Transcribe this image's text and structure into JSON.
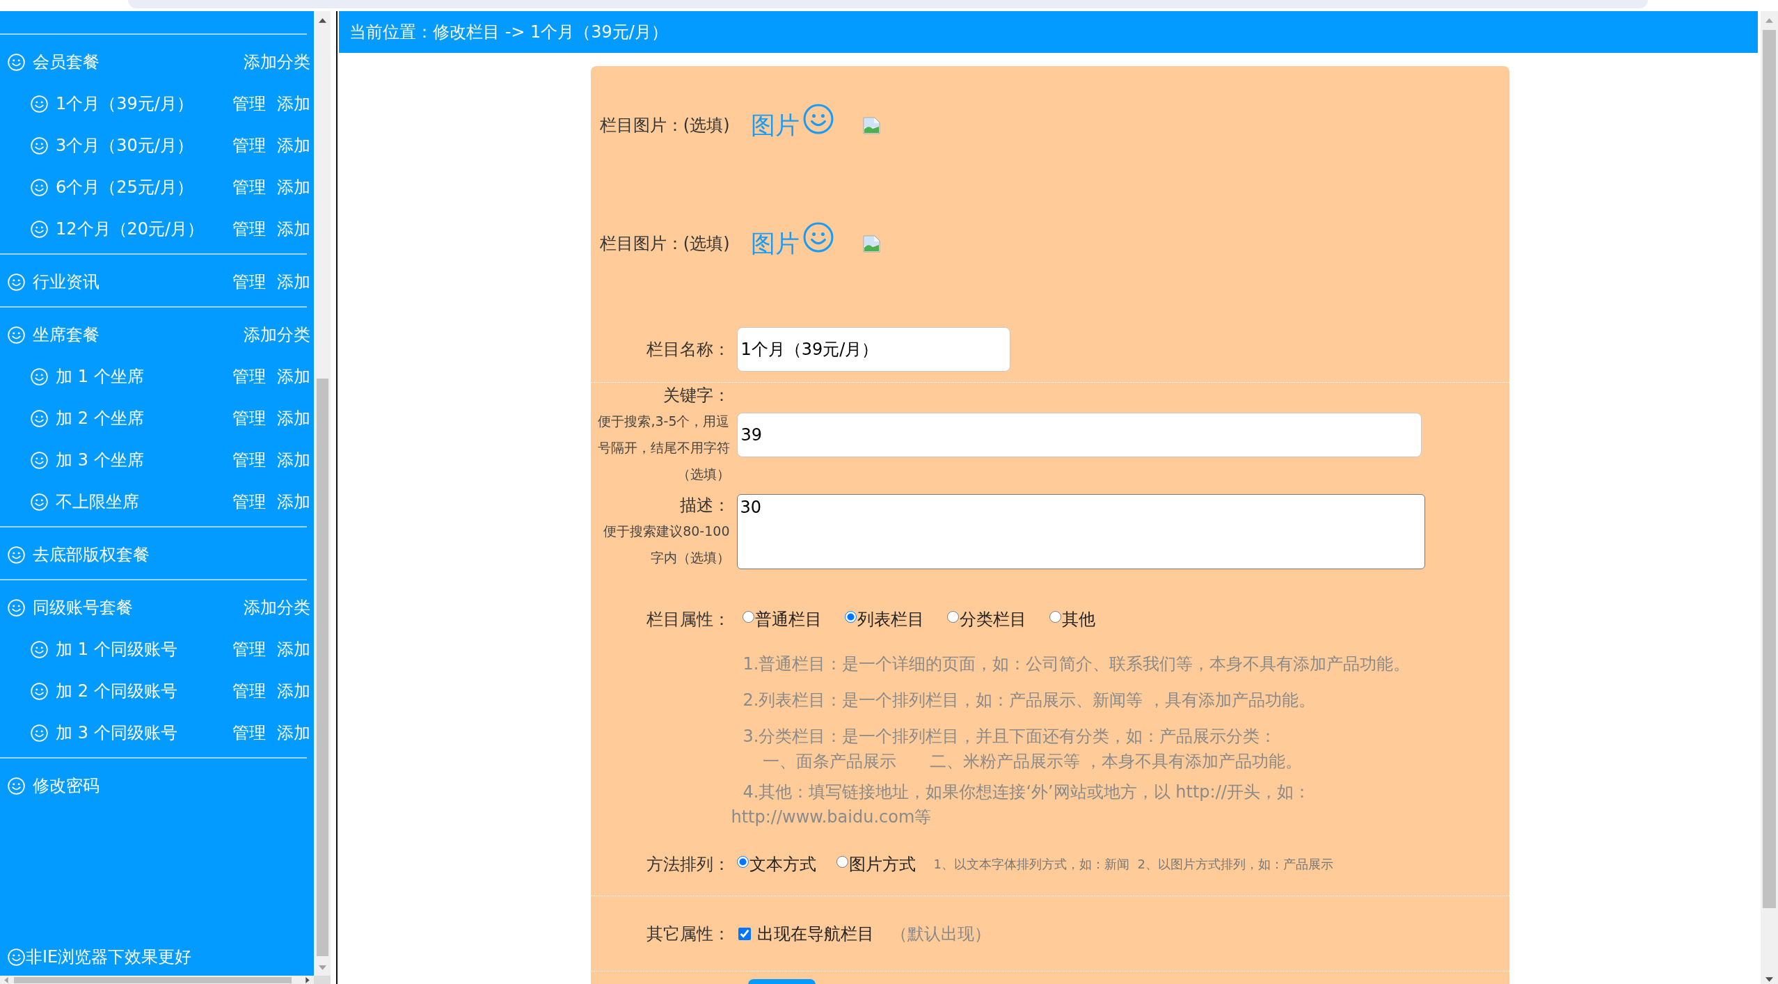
{
  "sidebar": {
    "groups": [
      {
        "label": "会员套餐",
        "actions": [
          "添加分类"
        ],
        "children": [
          {
            "label": "1个月（39元/月）",
            "actions": [
              "管理",
              "添加"
            ]
          },
          {
            "label": "3个月（30元/月）",
            "actions": [
              "管理",
              "添加"
            ]
          },
          {
            "label": "6个月（25元/月）",
            "actions": [
              "管理",
              "添加"
            ]
          },
          {
            "label": "12个月（20元/月）",
            "actions": [
              "管理",
              "添加"
            ]
          }
        ]
      },
      {
        "label": "行业资讯",
        "actions": [
          "管理",
          "添加"
        ]
      },
      {
        "label": "坐席套餐",
        "actions": [
          "添加分类"
        ],
        "children": [
          {
            "label": "加 1 个坐席",
            "actions": [
              "管理",
              "添加"
            ]
          },
          {
            "label": "加 2 个坐席",
            "actions": [
              "管理",
              "添加"
            ]
          },
          {
            "label": "加 3 个坐席",
            "actions": [
              "管理",
              "添加"
            ]
          },
          {
            "label": "不上限坐席",
            "actions": [
              "管理",
              "添加"
            ]
          }
        ]
      },
      {
        "label": "去底部版权套餐"
      },
      {
        "label": "同级账号套餐",
        "actions": [
          "添加分类"
        ],
        "children": [
          {
            "label": "加 1 个同级账号",
            "actions": [
              "管理",
              "添加"
            ]
          },
          {
            "label": "加 2 个同级账号",
            "actions": [
              "管理",
              "添加"
            ]
          },
          {
            "label": "加 3 个同级账号",
            "actions": [
              "管理",
              "添加"
            ]
          }
        ]
      },
      {
        "label": "修改密码"
      }
    ],
    "footer": "非IE浏览器下效果更好"
  },
  "breadcrumb": "当前位置：修改栏目 -> 1个月（39元/月）",
  "form": {
    "image_fields": [
      {
        "label": "栏目图片：(选填)",
        "button": "图片"
      },
      {
        "label": "栏目图片：(选填)",
        "button": "图片"
      }
    ],
    "name_field": {
      "label": "栏目名称：",
      "value": "1个月（39元/月）"
    },
    "keywords_field": {
      "label": "关键字：",
      "hint_lines": [
        "便于搜索,3-5个，用逗",
        "号隔开，结尾不用字符",
        "（选填）"
      ],
      "value": "39"
    },
    "description_field": {
      "label": "描述：",
      "hint_lines": [
        "便于搜索建议80-100",
        "字内（选填）"
      ],
      "value": "30"
    },
    "type_field": {
      "label": "栏目属性：",
      "options": [
        {
          "label": "普通栏目",
          "selected": false
        },
        {
          "label": "列表栏目",
          "selected": true
        },
        {
          "label": "分类栏目",
          "selected": false
        },
        {
          "label": "其他",
          "selected": false
        }
      ]
    },
    "type_notes": [
      {
        "kind": "item",
        "lines": [
          "1.普通栏目：是一个详细的页面，如：公司简介、联系我们等，本身不具有添加产品功能。"
        ]
      },
      {
        "kind": "item",
        "lines": [
          "2.列表栏目：是一个排列栏目，如：产品展示、新闻等 ，具有添加产品功能。"
        ]
      },
      {
        "kind": "item",
        "lines": [
          "3.分类栏目：是一个排列栏目，并且下面还有分类，如：产品展示分类："
        ]
      },
      {
        "kind": "sub",
        "lines": [
          "一、面条产品展示　　二、米粉产品展示等 ，本身不具有添加产品功能。"
        ]
      },
      {
        "kind": "item",
        "lines": [
          "4.其他：填写链接地址，如果你想连接‘外’网站或地方，以 http://开头，如：",
          "http://www.baidu.com等"
        ]
      }
    ],
    "layout_field": {
      "label": "方法排列：",
      "options": [
        {
          "label": "文本方式",
          "selected": true
        },
        {
          "label": "图片方式",
          "selected": false
        }
      ],
      "hint": "1、以文本字体排列方式，如：新闻  2、以图片方式排列，如：产品展示"
    },
    "other_field": {
      "label": "其它属性：",
      "checkbox": {
        "label": "出现在导航栏目",
        "checked": true
      },
      "note": "（默认出现）"
    }
  }
}
